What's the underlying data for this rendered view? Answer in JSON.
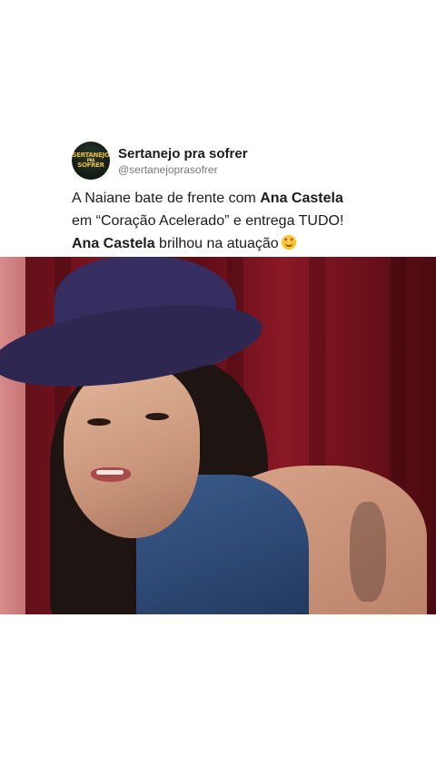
{
  "post": {
    "author": {
      "display_name": "Sertanejo pra sofrer",
      "handle": "@sertanejoprasofrer",
      "avatar_logo": {
        "line1": "SERTANEJO",
        "line2": "PRA",
        "line3": "SOFRER"
      }
    },
    "text": {
      "line1_prefix": "A Naiane bate de frente com ",
      "line1_bold": "Ana Castela",
      "line2": "em “Coração Acelerado” e entrega TUDO!",
      "line3_bold": "Ana Castela",
      "line3_suffix": " brilhou na atuação"
    },
    "emoji": "heart-eyes-emoji"
  },
  "colors": {
    "background": "#ffffff",
    "text": "#1c1c1c",
    "handle": "#7a7a7a",
    "logo_gold": "#e8b93a"
  }
}
